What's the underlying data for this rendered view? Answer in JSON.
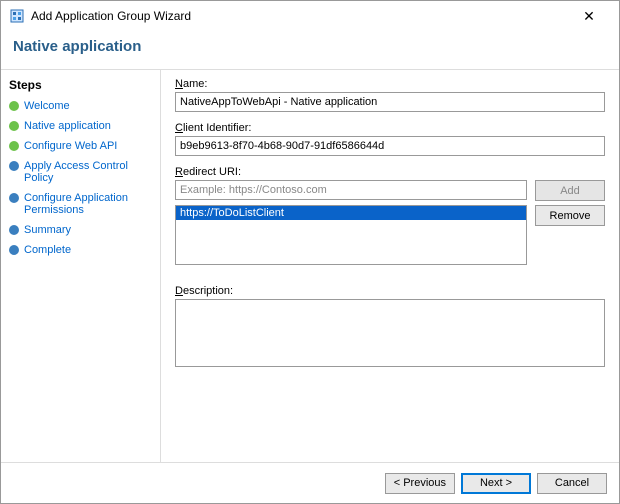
{
  "window": {
    "title": "Add Application Group Wizard",
    "close": "✕"
  },
  "subheader": "Native application",
  "steps": {
    "heading": "Steps",
    "items": [
      {
        "label": "Welcome",
        "state": "done"
      },
      {
        "label": "Native application",
        "state": "current"
      },
      {
        "label": "Configure Web API",
        "state": "done"
      },
      {
        "label": "Apply Access Control Policy",
        "state": "todo"
      },
      {
        "label": "Configure Application Permissions",
        "state": "todo"
      },
      {
        "label": "Summary",
        "state": "todo"
      },
      {
        "label": "Complete",
        "state": "todo"
      }
    ]
  },
  "form": {
    "name_label_pre": "N",
    "name_label_rest": "ame:",
    "name_value": "NativeAppToWebApi - Native application",
    "client_id_label_pre": "C",
    "client_id_label_rest": "lient Identifier:",
    "client_id_value": "b9eb9613-8f70-4b68-90d7-91df6586644d",
    "redirect_label_pre": "R",
    "redirect_label_rest": "edirect URI:",
    "redirect_placeholder": "Example: https://Contoso.com",
    "redirect_items": [
      "https://ToDoListClient"
    ],
    "add_pre": "A",
    "add_rest": "dd",
    "remove_pre": "R",
    "remove_rest": "emove",
    "desc_label_pre": "D",
    "desc_label_rest": "escription:",
    "desc_value": ""
  },
  "footer": {
    "previous": "< Previous",
    "next": "Next >",
    "cancel": "Cancel"
  }
}
